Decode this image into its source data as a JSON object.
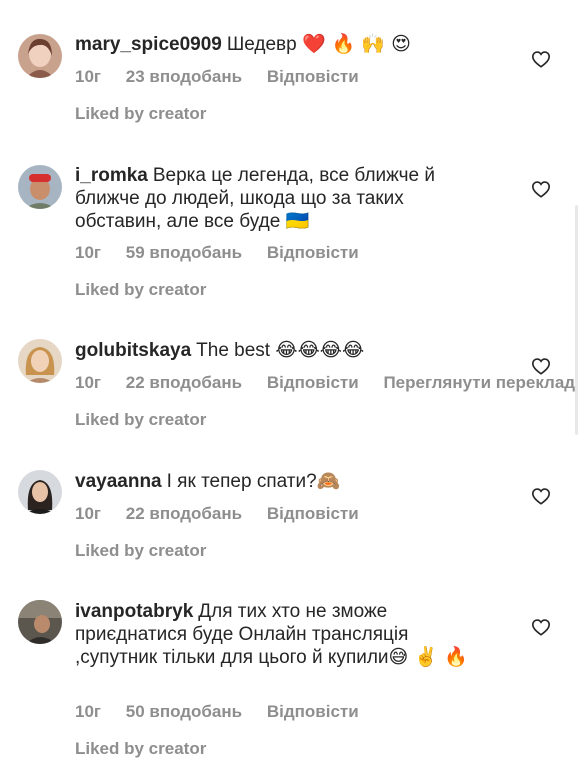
{
  "comments": [
    {
      "username": "mary_spice0909",
      "text": "Шедевр",
      "emoji": "❤️ 🔥 🙌 😍",
      "time": "10г",
      "likes": "23 вподобань",
      "reply": "Відповісти",
      "liked_by": "Liked by creator"
    },
    {
      "username": "i_romka",
      "text": "Верка це легенда,  все ближче  й ближче до людей, шкода що за таких обставин, але все буде",
      "emoji": "🇺🇦",
      "time": "10г",
      "likes": "59 вподобань",
      "reply": "Відповісти",
      "liked_by": "Liked by creator"
    },
    {
      "username": "golubitskaya",
      "text": "The best",
      "emoji": "😂😂😂😂",
      "time": "10г",
      "likes": "22 вподобань",
      "reply": "Відповісти",
      "translate": "Переглянути переклад",
      "liked_by": "Liked by creator"
    },
    {
      "username": "vayaanna",
      "text": "І як тепер спати?",
      "emoji": "🙈",
      "time": "10г",
      "likes": "22 вподобань",
      "reply": "Відповісти",
      "liked_by": "Liked by creator"
    },
    {
      "username": "ivanpotabryk",
      "text": "Для тих хто не зможе приєднатися буде Онлайн трансляція ,супутник тільки для цього й купили",
      "emoji": "😅 ✌️ 🔥",
      "time": "10г",
      "likes": "50 вподобань",
      "reply": "Відповісти",
      "liked_by": "Liked by creator"
    }
  ],
  "icons": {
    "like": "heart-outline-icon"
  },
  "colors": {
    "text": "#262626",
    "secondary": "#8e8e8e",
    "background": "#ffffff"
  }
}
